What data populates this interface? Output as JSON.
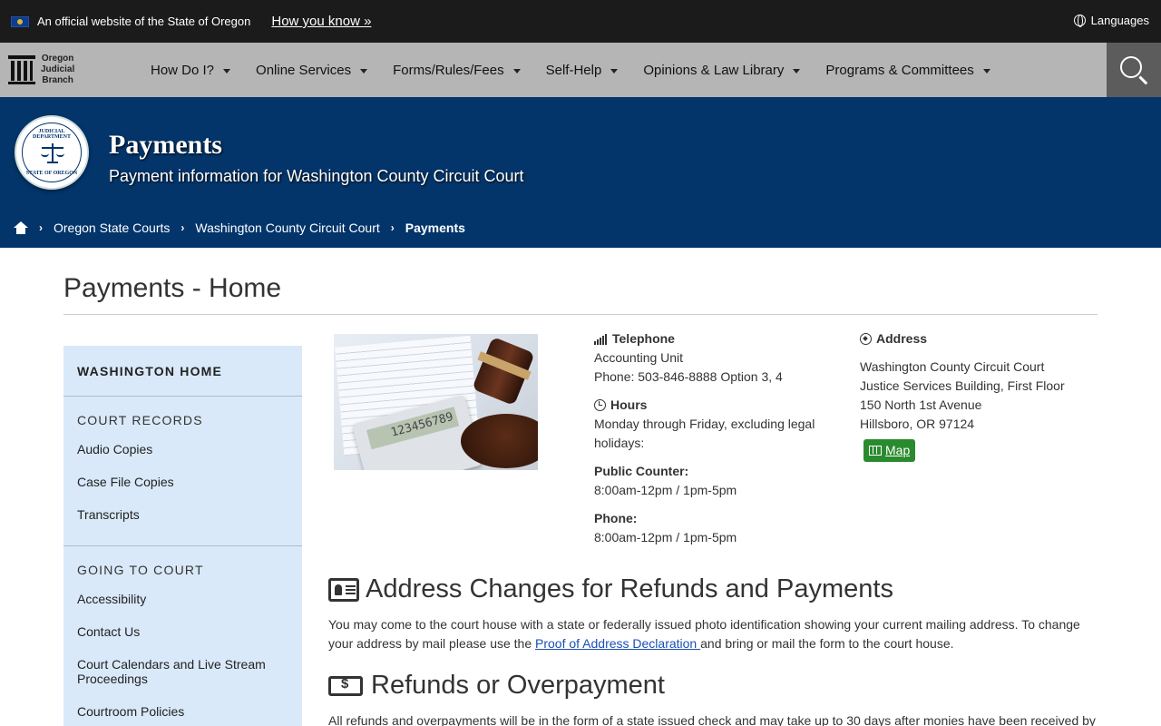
{
  "topbar": {
    "official_text": "An official website of the State of Oregon",
    "how_you_know": "How you know »",
    "languages": "Languages"
  },
  "nav": {
    "logo_lines": [
      "Oregon",
      "Judicial",
      "Branch"
    ],
    "items": [
      {
        "label": "How Do I?"
      },
      {
        "label": "Online Services"
      },
      {
        "label": "Forms/Rules/Fees"
      },
      {
        "label": "Self-Help"
      },
      {
        "label": "Opinions & Law Library"
      },
      {
        "label": "Programs & Committees"
      }
    ]
  },
  "banner": {
    "seal_top": "JUDICIAL DEPARTMENT",
    "seal_bottom": "STATE OF OREGON",
    "title": "Payments",
    "subtitle": "Payment information for Washington County Circuit Court"
  },
  "breadcrumbs": [
    "Oregon State Courts",
    "Washington County Circuit Court",
    "Payments"
  ],
  "page_title": "Payments - Home",
  "sidebar": {
    "home": "WASHINGTON HOME",
    "sections": [
      {
        "title": "COURT RECORDS",
        "links": [
          "Audio Copies",
          "Case File Copies",
          "Transcripts"
        ]
      },
      {
        "title": "GOING TO COURT",
        "links": [
          "Accessibility",
          "Contact Us",
          "Court Calendars and Live Stream Proceedings",
          "Courtroom Policies"
        ]
      }
    ]
  },
  "photo": {
    "calc_display": "123456789"
  },
  "contact": {
    "telephone_label": "Telephone",
    "unit": "Accounting Unit",
    "phone": "Phone: 503-846-8888 Option 3, 4",
    "hours_label": "Hours",
    "hours_text": "Monday through Friday, excluding legal holidays:",
    "counter_label": "Public Counter:",
    "counter_hours": "8:00am-12pm / 1pm-5pm",
    "phone_label": "Phone:",
    "phone_hours": "8:00am-12pm / 1pm-5pm"
  },
  "address": {
    "label": "Address",
    "lines": [
      "Washington County Circuit Court",
      "Justice Services Building, First Floor",
      "150 North 1st Avenue",
      "Hillsboro, OR 97124"
    ],
    "map_button": "Map"
  },
  "sections": {
    "address_change": {
      "heading": "Address Changes for Refunds and Payments",
      "text_before": "You may come to the court house with a state or federally issued photo identification showing your current mailing address. To change your address by mail please use the ",
      "link": "Proof of Address Declaration ",
      "text_after": "and bring or mail the form to the court house."
    },
    "refunds": {
      "heading": "Refunds or Overpayment",
      "text": "All refunds and overpayments will be in the form of a state issued check and may take up to 30 days after monies have been received by"
    }
  },
  "colors": {
    "topbar": "#1b1b1b",
    "navbar": "#b5b5b5",
    "banner": "#03356b",
    "sidebar": "#d9e9f9",
    "map_button": "#2a8a2e"
  }
}
